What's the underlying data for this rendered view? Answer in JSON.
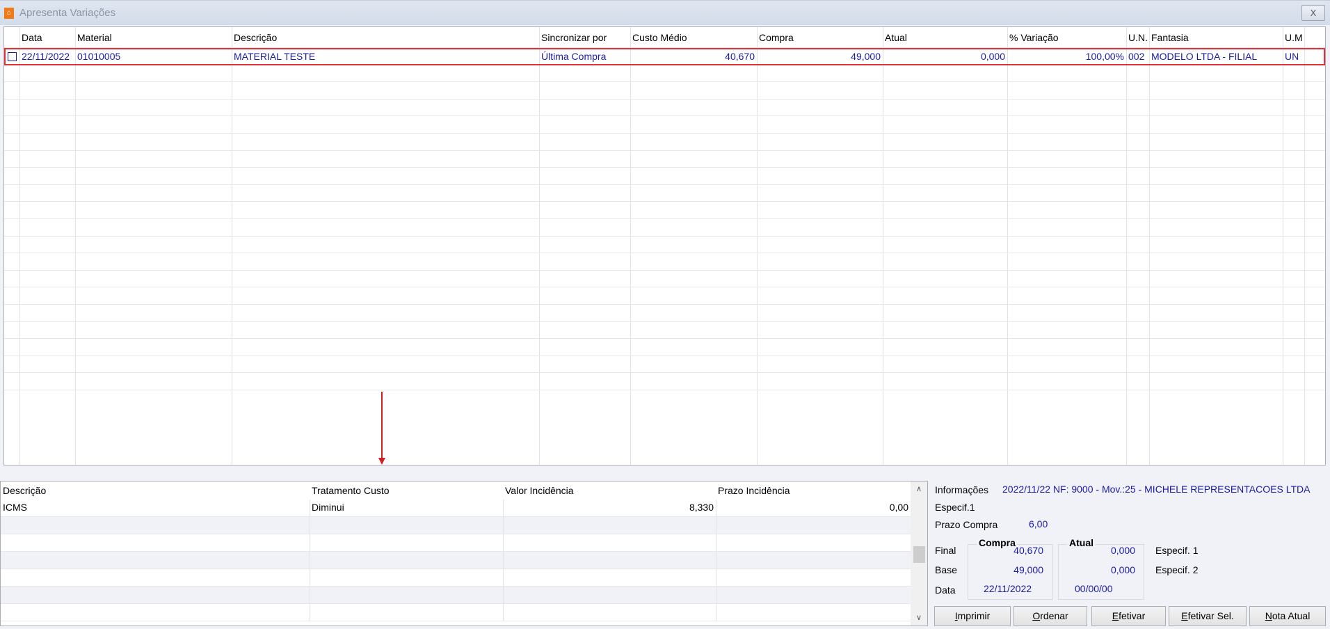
{
  "window": {
    "title": "Apresenta Variações",
    "close_label": "X"
  },
  "top_grid": {
    "columns": [
      "",
      "Data",
      "Material",
      "Descrição",
      "Sincronizar por",
      "Custo Médio",
      "Compra",
      "Atual",
      "% Variação",
      "U.N.",
      "Fantasia",
      "U.M",
      ""
    ],
    "rows": [
      {
        "checked": false,
        "data": "22/11/2022",
        "material": "01010005",
        "descricao": "MATERIAL TESTE",
        "sincronizar": "Última Compra",
        "custo_medio": "40,670",
        "compra": "49,000",
        "atual": "0,000",
        "variacao": "100,00%",
        "un": "002",
        "fantasia": "MODELO LTDA - FILIAL",
        "um": "UN"
      }
    ]
  },
  "bottom_grid": {
    "columns": [
      "Descrição",
      "Tratamento Custo",
      "Valor Incidência",
      "Prazo Incidência"
    ],
    "rows": [
      {
        "descricao": "ICMS",
        "tratamento": "Diminui",
        "valor": "8,330",
        "prazo": "0,00"
      }
    ]
  },
  "info": {
    "informacoes_label": "Informações",
    "informacoes_value": "2022/11/22 NF: 9000 -  Mov.:25 - MICHELE REPRESENTACOES LTDA",
    "especif1_label": "Especif.1",
    "prazo_label": "Prazo Compra",
    "prazo_value": "6,00",
    "compra_title": "Compra",
    "atual_title": "Atual",
    "final_label": "Final",
    "base_label": "Base",
    "data_label": "Data",
    "compra_final": "40,670",
    "compra_base": "49,000",
    "compra_data": "22/11/2022",
    "atual_final": "0,000",
    "atual_base": "0,000",
    "atual_data": "00/00/00",
    "especif_1": "Especif. 1",
    "especif_2": "Especif. 2"
  },
  "buttons": [
    {
      "key": "I",
      "rest": "mprimir"
    },
    {
      "key": "O",
      "rest": "rdenar"
    },
    {
      "key": "E",
      "rest": "fetivar"
    },
    {
      "key": "E",
      "rest": "fetivar Sel."
    },
    {
      "key": "N",
      "rest": "ota Atual"
    }
  ]
}
